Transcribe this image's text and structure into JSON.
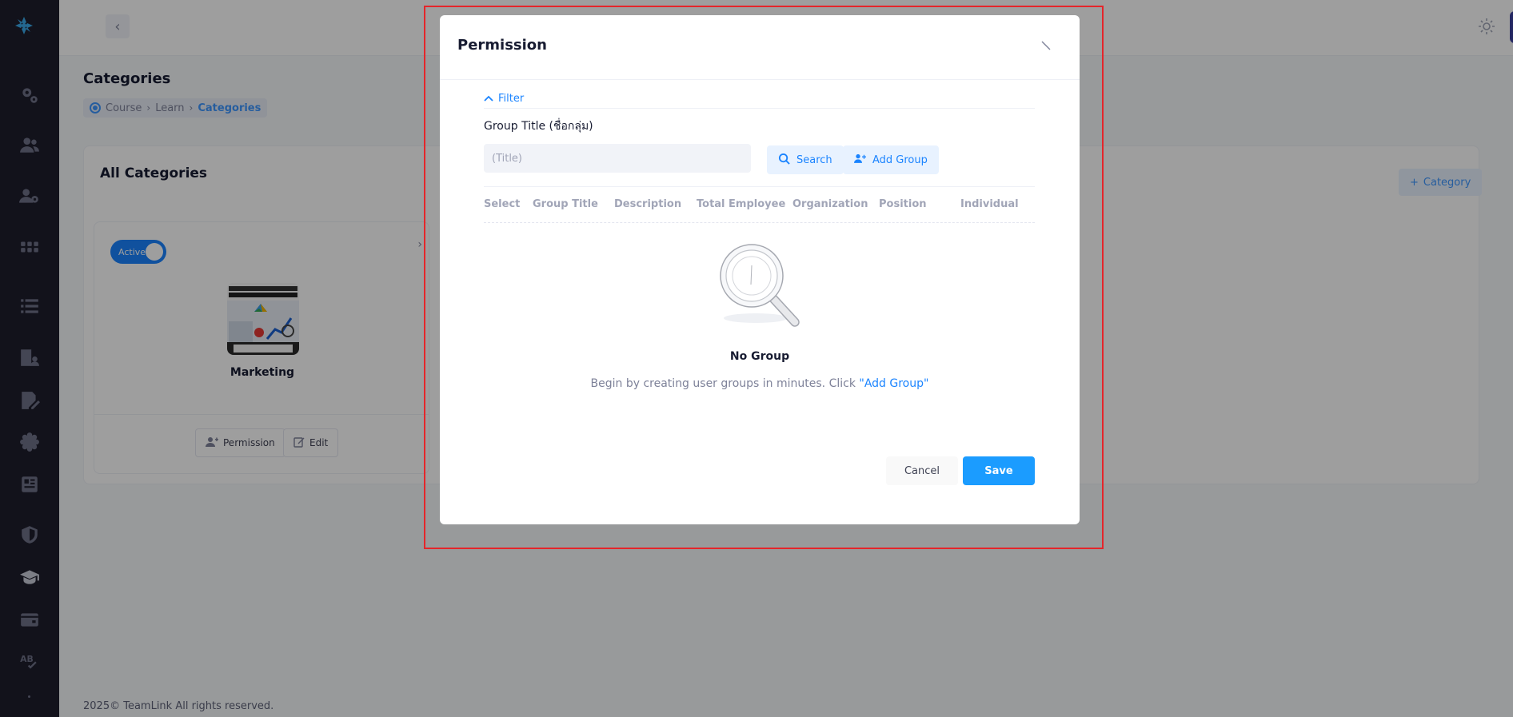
{
  "topbar": {
    "collapse_icon": "chevron-left-icon",
    "theme_icon": "sun-icon"
  },
  "page": {
    "title": "Categories",
    "breadcrumb": [
      "Course",
      "Learn",
      "Categories"
    ]
  },
  "card": {
    "title": "All Categories",
    "add_button": "Category",
    "category": {
      "status": "Active",
      "name": "Marketing",
      "permission_button": "Permission",
      "edit_button": "Edit"
    }
  },
  "footer": {
    "copyright": "2025© TeamLink All rights reserved."
  },
  "modal": {
    "title": "Permission",
    "filter_label": "Filter",
    "field_label": "Group Title (ชื่อกลุ่ม)",
    "title_placeholder": "(Title)",
    "search_button": "Search",
    "add_group_button": "Add Group",
    "columns": [
      "Select",
      "Group Title",
      "Description",
      "Total Employee",
      "Organization",
      "Position",
      "Individual"
    ],
    "empty_title": "No Group",
    "empty_text": "Begin by creating user groups in minutes. Click ",
    "empty_link": "\"Add Group\"",
    "cancel_button": "Cancel",
    "save_button": "Save"
  },
  "colors": {
    "primary": "#1b84ff",
    "overlay": "rgba(0,0,0,0.38)",
    "highlight": "#e5252a",
    "sidebar": "#1e1e2d"
  }
}
